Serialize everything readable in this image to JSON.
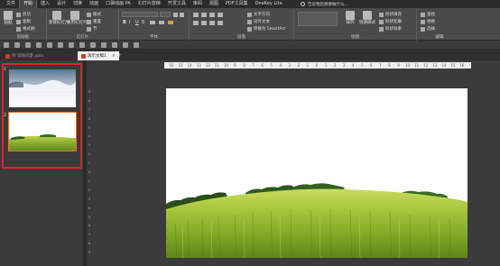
{
  "menu": {
    "items": [
      "文件",
      "开始",
      "插入",
      "设计",
      "切换",
      "动画",
      "口袋动画 PA",
      "幻灯片放映",
      "开发工具",
      "审阅",
      "视图",
      "PDF工具集",
      "OneKey Lite"
    ],
    "active_index": 1,
    "tell_me": "告诉我您想要做什么..."
  },
  "ribbon": {
    "clipboard": {
      "paste": "粘贴",
      "cut": "剪切",
      "copy": "复制",
      "format_painter": "格式刷",
      "label": "剪贴板"
    },
    "slides": {
      "new_slide": "新建幻灯片",
      "reuse_slide": "重用幻灯片",
      "layout": "版式",
      "reset": "重置",
      "section": "节",
      "label": "幻灯片"
    },
    "font": {
      "label": "字体",
      "bold": "B",
      "italic": "I",
      "underline": "U",
      "shadow": "S"
    },
    "paragraph": {
      "label": "段落",
      "text_direction": "文字方向",
      "align_text": "对齐文本",
      "smartart": "转换为 SmartArt"
    },
    "drawing": {
      "label": "绘图",
      "arrange": "排列",
      "quick_styles": "快速样式",
      "shape_fill": "形状填充",
      "shape_outline": "形状轮廓",
      "shape_effects": "形状效果"
    },
    "editing": {
      "label": "编辑",
      "find": "查找",
      "replace": "替换",
      "select": "选择"
    }
  },
  "tabs": [
    {
      "label": "桥 湿地风景.pptx",
      "active": false
    },
    {
      "label": "演示文稿1",
      "active": true
    }
  ],
  "thumbnails": [
    {
      "number": "1"
    },
    {
      "number": "2"
    }
  ],
  "ruler": {
    "horizontal": [
      "16",
      "15",
      "14",
      "13",
      "12",
      "11",
      "10",
      "9",
      "8",
      "7",
      "6",
      "5",
      "4",
      "3",
      "2",
      "1",
      "0",
      "1",
      "2",
      "3",
      "4",
      "5",
      "6",
      "7",
      "8",
      "9",
      "10",
      "11",
      "12",
      "13",
      "14",
      "15",
      "16"
    ],
    "vertical": [
      "9",
      "8",
      "7",
      "6",
      "5",
      "4",
      "3",
      "2",
      "1",
      "0",
      "1",
      "2",
      "3",
      "4",
      "5",
      "6",
      "7",
      "8",
      "9"
    ]
  },
  "colors": {
    "selection_highlight": "#d8262c",
    "sky_top": "#6e8aa8",
    "grass": "#8fb82c",
    "trees": "#2f5a1c"
  }
}
